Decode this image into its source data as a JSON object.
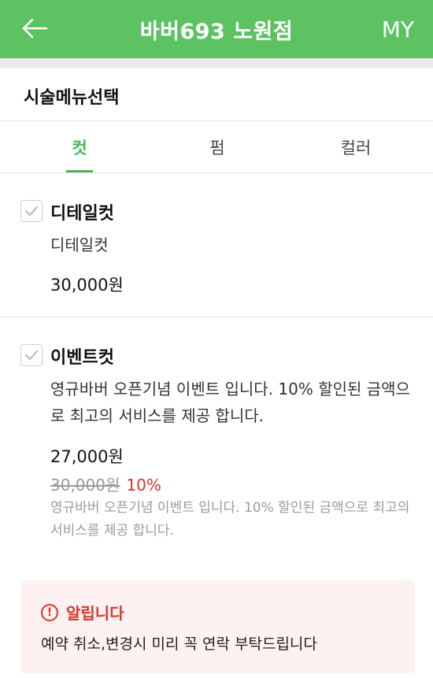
{
  "header": {
    "back_icon": "arrow-left-icon",
    "title": "바버693 노원점",
    "my_label": "MY",
    "bg_color": "#5dc262"
  },
  "section": {
    "title": "시술메뉴선택"
  },
  "tabs": [
    {
      "label": "컷",
      "active": true
    },
    {
      "label": "펌",
      "active": false
    },
    {
      "label": "컬러",
      "active": false
    }
  ],
  "accent_color": "#4bb657",
  "items": [
    {
      "name": "디테일컷",
      "description": "디테일컷",
      "price": "30,000원",
      "checked": false
    },
    {
      "name": "이벤트컷",
      "description": "영규바버 오픈기념 이벤트 입니다. 10% 할인된 금액으로 최고의 서비스를 제공 합니다.",
      "price": "27,000원",
      "original_price": "30,000원",
      "discount": "10%",
      "note": "영규바버 오픈기념 이벤트 입니다. 10% 할인된 금액으로 최고의 서비스를 제공 합니다.",
      "checked": false
    }
  ],
  "notice": {
    "icon": "exclamation-circle-icon",
    "title": "알립니다",
    "message": "예약 취소,변경시 미리 꼭 연락 부탁드립니다",
    "color": "#d9342b"
  }
}
